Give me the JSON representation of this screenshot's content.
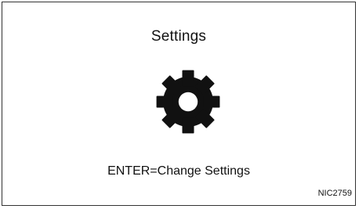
{
  "screen": {
    "title": "Settings",
    "icon": "gear-icon",
    "instruction": "ENTER=Change Settings"
  },
  "figure_code": "NIC2759"
}
